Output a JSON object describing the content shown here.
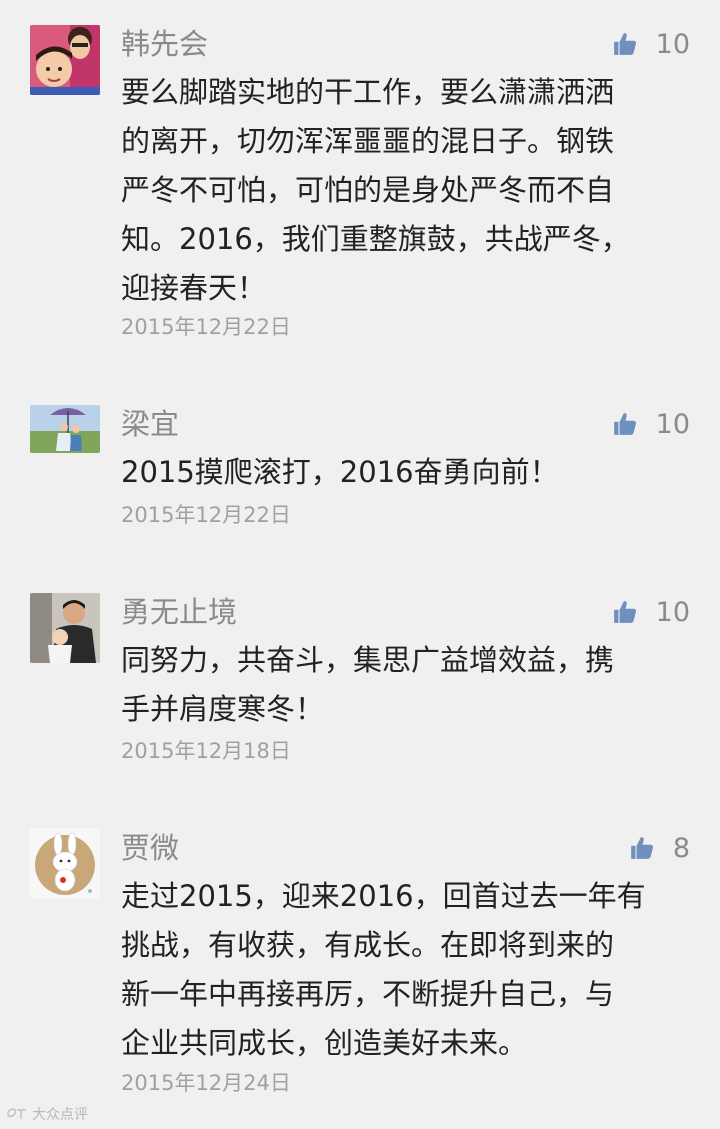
{
  "colors": {
    "background": "#f0f0f0",
    "name": "#8a8a8a",
    "body_text": "#222222",
    "date": "#a0a0a0",
    "thumb": "#6f8fbf"
  },
  "comments": [
    {
      "name": "韩先会",
      "likes": "10",
      "lines": [
        "要么脚踏实地的干工作，要么潇潇洒洒",
        "的离开，切勿浑浑噩噩的混日子。钢铁",
        "严冬不可怕，可怕的是身处严冬而不自",
        "知。2016，我们重整旗鼓，共战严冬，",
        "迎接春天！"
      ],
      "date": "2015年12月22日",
      "avatar_icon": "photo-avatar-child"
    },
    {
      "name": "梁宜",
      "likes": "10",
      "lines": [
        "2015摸爬滚打，2016奋勇向前！"
      ],
      "date": "2015年12月22日",
      "avatar_icon": "photo-avatar-umbrella"
    },
    {
      "name": "勇无止境",
      "likes": "10",
      "lines": [
        "同努力，共奋斗，集思广益增效益，携",
        "手并肩度寒冬！"
      ],
      "date": "2015年12月18日",
      "avatar_icon": "photo-avatar-man-baby"
    },
    {
      "name": "贾微",
      "likes": "8",
      "lines": [
        "走过2015，迎来2016，回首过去一年有",
        "挑战，有收获，有成长。在即将到来的",
        "新一年中再接再厉，不断提升自己，与",
        "企业共同成长，创造美好未来。"
      ],
      "date": "2015年12月24日",
      "avatar_icon": "rabbit-avatar"
    }
  ],
  "watermark": {
    "text": "大众点评"
  }
}
